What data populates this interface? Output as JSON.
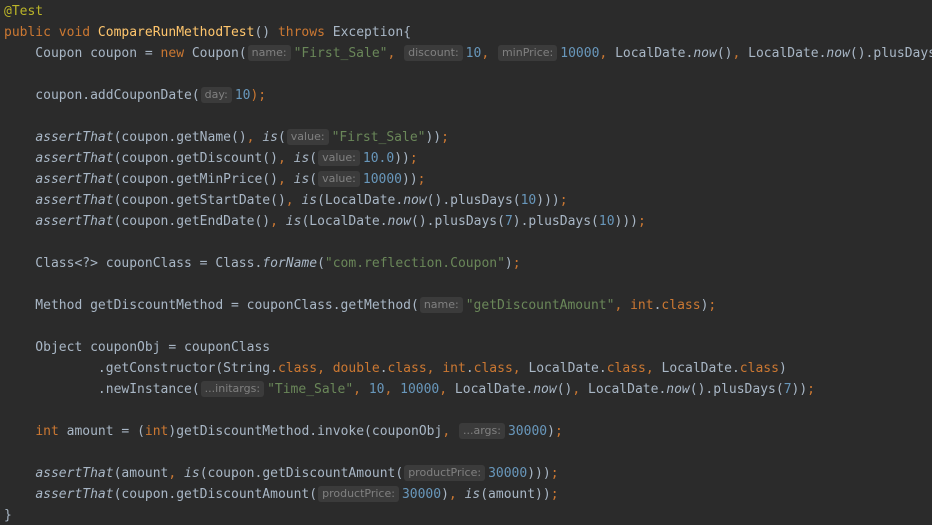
{
  "editor": {
    "lines": [
      [
        {
          "t": "@Test",
          "c": "tok-ann"
        }
      ],
      [
        {
          "t": "public void ",
          "c": "tok-kw"
        },
        {
          "t": "CompareRunMethodTest",
          "c": "tok-fn"
        },
        {
          "t": "() ",
          "c": "tok-plain"
        },
        {
          "t": "throws ",
          "c": "tok-kw"
        },
        {
          "t": "Exception{",
          "c": "tok-plain"
        }
      ],
      [
        {
          "t": "    Coupon coupon = ",
          "c": "tok-plain"
        },
        {
          "t": "new ",
          "c": "tok-kw"
        },
        {
          "t": "Coupon(",
          "c": "tok-plain"
        },
        {
          "t": "name:",
          "c": "hint"
        },
        {
          "t": "\"First_Sale\"",
          "c": "tok-str"
        },
        {
          "t": ", ",
          "c": "tok-kw"
        },
        {
          "t": "discount:",
          "c": "hint"
        },
        {
          "t": "10",
          "c": "tok-num"
        },
        {
          "t": ", ",
          "c": "tok-kw"
        },
        {
          "t": "minPrice:",
          "c": "hint"
        },
        {
          "t": "10000",
          "c": "tok-num"
        },
        {
          "t": ", ",
          "c": "tok-kw"
        },
        {
          "t": "LocalDate.",
          "c": "tok-plain"
        },
        {
          "t": "now",
          "c": "tok-it"
        },
        {
          "t": "()",
          "c": "tok-plain"
        },
        {
          "t": ", ",
          "c": "tok-kw"
        },
        {
          "t": "LocalDate.",
          "c": "tok-plain"
        },
        {
          "t": "now",
          "c": "tok-it"
        },
        {
          "t": "().plusDays(",
          "c": "tok-plain"
        }
      ],
      [],
      [
        {
          "t": "    coupon.addCouponDate(",
          "c": "tok-plain"
        },
        {
          "t": "day:",
          "c": "hint"
        },
        {
          "t": "10",
          "c": "tok-num"
        },
        {
          "t": ");",
          "c": "tok-kw"
        }
      ],
      [],
      [
        {
          "t": "    ",
          "c": "tok-plain"
        },
        {
          "t": "assertThat",
          "c": "tok-it"
        },
        {
          "t": "(coupon.getName()",
          "c": "tok-plain"
        },
        {
          "t": ", ",
          "c": "tok-kw"
        },
        {
          "t": "is",
          "c": "tok-it"
        },
        {
          "t": "(",
          "c": "tok-plain"
        },
        {
          "t": "value:",
          "c": "hint"
        },
        {
          "t": "\"First_Sale\"",
          "c": "tok-str"
        },
        {
          "t": "))",
          "c": "tok-plain"
        },
        {
          "t": ";",
          "c": "tok-kw"
        }
      ],
      [
        {
          "t": "    ",
          "c": "tok-plain"
        },
        {
          "t": "assertThat",
          "c": "tok-it"
        },
        {
          "t": "(coupon.getDiscount()",
          "c": "tok-plain"
        },
        {
          "t": ", ",
          "c": "tok-kw"
        },
        {
          "t": "is",
          "c": "tok-it"
        },
        {
          "t": "(",
          "c": "tok-plain"
        },
        {
          "t": "value:",
          "c": "hint"
        },
        {
          "t": "10.0",
          "c": "tok-num"
        },
        {
          "t": "))",
          "c": "tok-plain"
        },
        {
          "t": ";",
          "c": "tok-kw"
        }
      ],
      [
        {
          "t": "    ",
          "c": "tok-plain"
        },
        {
          "t": "assertThat",
          "c": "tok-it"
        },
        {
          "t": "(coupon.getMinPrice()",
          "c": "tok-plain"
        },
        {
          "t": ", ",
          "c": "tok-kw"
        },
        {
          "t": "is",
          "c": "tok-it"
        },
        {
          "t": "(",
          "c": "tok-plain"
        },
        {
          "t": "value:",
          "c": "hint"
        },
        {
          "t": "10000",
          "c": "tok-num"
        },
        {
          "t": "))",
          "c": "tok-plain"
        },
        {
          "t": ";",
          "c": "tok-kw"
        }
      ],
      [
        {
          "t": "    ",
          "c": "tok-plain"
        },
        {
          "t": "assertThat",
          "c": "tok-it"
        },
        {
          "t": "(coupon.getStartDate()",
          "c": "tok-plain"
        },
        {
          "t": ", ",
          "c": "tok-kw"
        },
        {
          "t": "is",
          "c": "tok-it"
        },
        {
          "t": "(LocalDate.",
          "c": "tok-plain"
        },
        {
          "t": "now",
          "c": "tok-it"
        },
        {
          "t": "().plusDays(",
          "c": "tok-plain"
        },
        {
          "t": "10",
          "c": "tok-num"
        },
        {
          "t": ")))",
          "c": "tok-plain"
        },
        {
          "t": ";",
          "c": "tok-kw"
        }
      ],
      [
        {
          "t": "    ",
          "c": "tok-plain"
        },
        {
          "t": "assertThat",
          "c": "tok-it"
        },
        {
          "t": "(coupon.getEndDate()",
          "c": "tok-plain"
        },
        {
          "t": ", ",
          "c": "tok-kw"
        },
        {
          "t": "is",
          "c": "tok-it"
        },
        {
          "t": "(LocalDate.",
          "c": "tok-plain"
        },
        {
          "t": "now",
          "c": "tok-it"
        },
        {
          "t": "().plusDays(",
          "c": "tok-plain"
        },
        {
          "t": "7",
          "c": "tok-num"
        },
        {
          "t": ").plusDays(",
          "c": "tok-plain"
        },
        {
          "t": "10",
          "c": "tok-num"
        },
        {
          "t": ")))",
          "c": "tok-plain"
        },
        {
          "t": ";",
          "c": "tok-kw"
        }
      ],
      [],
      [
        {
          "t": "    Class<?> couponClass = Class.",
          "c": "tok-plain"
        },
        {
          "t": "forName",
          "c": "tok-it"
        },
        {
          "t": "(",
          "c": "tok-plain"
        },
        {
          "t": "\"com.reflection.Coupon\"",
          "c": "tok-str"
        },
        {
          "t": ")",
          "c": "tok-plain"
        },
        {
          "t": ";",
          "c": "tok-kw"
        }
      ],
      [],
      [
        {
          "t": "    Method getDiscountMethod = couponClass.getMethod(",
          "c": "tok-plain"
        },
        {
          "t": "name:",
          "c": "hint"
        },
        {
          "t": "\"getDiscountAmount\"",
          "c": "tok-str"
        },
        {
          "t": ", ",
          "c": "tok-kw"
        },
        {
          "t": "int",
          "c": "tok-kw"
        },
        {
          "t": ".",
          "c": "tok-plain"
        },
        {
          "t": "class",
          "c": "tok-kw"
        },
        {
          "t": ")",
          "c": "tok-plain"
        },
        {
          "t": ";",
          "c": "tok-kw"
        }
      ],
      [],
      [
        {
          "t": "    Object couponObj = couponClass",
          "c": "tok-plain"
        }
      ],
      [
        {
          "t": "            .getConstructor(String.",
          "c": "tok-plain"
        },
        {
          "t": "class",
          "c": "tok-kw"
        },
        {
          "t": ", ",
          "c": "tok-kw"
        },
        {
          "t": "double",
          "c": "tok-kw"
        },
        {
          "t": ".",
          "c": "tok-plain"
        },
        {
          "t": "class",
          "c": "tok-kw"
        },
        {
          "t": ", ",
          "c": "tok-kw"
        },
        {
          "t": "int",
          "c": "tok-kw"
        },
        {
          "t": ".",
          "c": "tok-plain"
        },
        {
          "t": "class",
          "c": "tok-kw"
        },
        {
          "t": ", ",
          "c": "tok-kw"
        },
        {
          "t": "LocalDate.",
          "c": "tok-plain"
        },
        {
          "t": "class",
          "c": "tok-kw"
        },
        {
          "t": ", ",
          "c": "tok-kw"
        },
        {
          "t": "LocalDate.",
          "c": "tok-plain"
        },
        {
          "t": "class",
          "c": "tok-kw"
        },
        {
          "t": ")",
          "c": "tok-plain"
        }
      ],
      [
        {
          "t": "            .newInstance(",
          "c": "tok-plain"
        },
        {
          "t": "...initargs:",
          "c": "hint"
        },
        {
          "t": "\"Time_Sale\"",
          "c": "tok-str"
        },
        {
          "t": ", ",
          "c": "tok-kw"
        },
        {
          "t": "10",
          "c": "tok-num"
        },
        {
          "t": ", ",
          "c": "tok-kw"
        },
        {
          "t": "10000",
          "c": "tok-num"
        },
        {
          "t": ", ",
          "c": "tok-kw"
        },
        {
          "t": "LocalDate.",
          "c": "tok-plain"
        },
        {
          "t": "now",
          "c": "tok-it"
        },
        {
          "t": "()",
          "c": "tok-plain"
        },
        {
          "t": ", ",
          "c": "tok-kw"
        },
        {
          "t": "LocalDate.",
          "c": "tok-plain"
        },
        {
          "t": "now",
          "c": "tok-it"
        },
        {
          "t": "().plusDays(",
          "c": "tok-plain"
        },
        {
          "t": "7",
          "c": "tok-num"
        },
        {
          "t": "))",
          "c": "tok-plain"
        },
        {
          "t": ";",
          "c": "tok-kw"
        }
      ],
      [],
      [
        {
          "t": "    ",
          "c": "tok-plain"
        },
        {
          "t": "int ",
          "c": "tok-kw"
        },
        {
          "t": "amount = (",
          "c": "tok-plain"
        },
        {
          "t": "int",
          "c": "tok-kw"
        },
        {
          "t": ")getDiscountMethod.invoke(couponObj",
          "c": "tok-plain"
        },
        {
          "t": ", ",
          "c": "tok-kw"
        },
        {
          "t": "...args:",
          "c": "hint"
        },
        {
          "t": "30000",
          "c": "tok-num"
        },
        {
          "t": ")",
          "c": "tok-plain"
        },
        {
          "t": ";",
          "c": "tok-kw"
        }
      ],
      [],
      [
        {
          "t": "    ",
          "c": "tok-plain"
        },
        {
          "t": "assertThat",
          "c": "tok-it"
        },
        {
          "t": "(amount",
          "c": "tok-plain"
        },
        {
          "t": ", ",
          "c": "tok-kw"
        },
        {
          "t": "is",
          "c": "tok-it"
        },
        {
          "t": "(coupon.getDiscountAmount(",
          "c": "tok-plain"
        },
        {
          "t": "productPrice:",
          "c": "hint"
        },
        {
          "t": "30000",
          "c": "tok-num"
        },
        {
          "t": ")))",
          "c": "tok-plain"
        },
        {
          "t": ";",
          "c": "tok-kw"
        }
      ],
      [
        {
          "t": "    ",
          "c": "tok-plain"
        },
        {
          "t": "assertThat",
          "c": "tok-it"
        },
        {
          "t": "(coupon.getDiscountAmount(",
          "c": "tok-plain"
        },
        {
          "t": "productPrice:",
          "c": "hint"
        },
        {
          "t": "30000",
          "c": "tok-num"
        },
        {
          "t": ")",
          "c": "tok-plain"
        },
        {
          "t": ", ",
          "c": "tok-kw"
        },
        {
          "t": "is",
          "c": "tok-it"
        },
        {
          "t": "(amount))",
          "c": "tok-plain"
        },
        {
          "t": ";",
          "c": "tok-kw"
        }
      ],
      [
        {
          "t": "}",
          "c": "tok-plain"
        }
      ]
    ]
  },
  "colors": {
    "background": "#2b2b2b",
    "plain": "#a9b7c6",
    "keyword": "#cc7832",
    "function": "#ffc66d",
    "string": "#6a8759",
    "number": "#6897bb",
    "annotation": "#bbb529",
    "hint_text": "#808080",
    "hint_background": "#3b3b3b"
  }
}
